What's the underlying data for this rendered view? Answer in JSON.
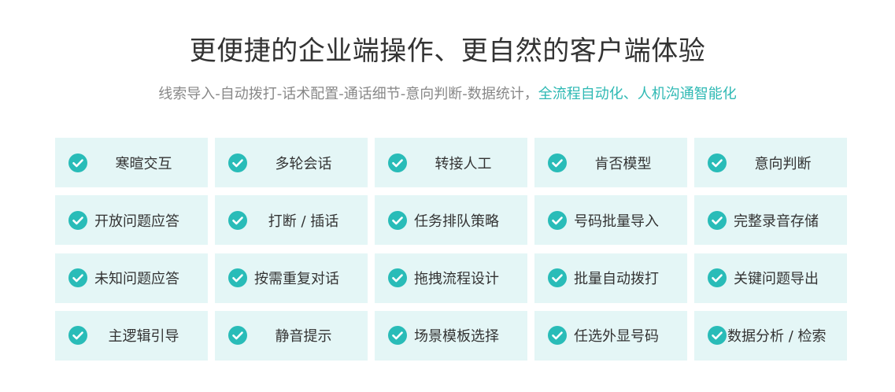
{
  "header": {
    "title": "更便捷的企业端操作、更自然的客户端体验",
    "subtitle_plain": "线索导入-自动拨打-话术配置-通话细节-意向判断-数据统计，",
    "subtitle_highlight": "全流程自动化、人机沟通智能化"
  },
  "colors": {
    "accent": "#29bcb8",
    "card_bg": "#e4f6f6",
    "title": "#333333",
    "subtitle": "#888888",
    "highlight": "#2fb9b4"
  },
  "features": [
    {
      "label": "寒暄交互",
      "icon": "check-circle-icon"
    },
    {
      "label": "多轮会话",
      "icon": "check-circle-icon"
    },
    {
      "label": "转接人工",
      "icon": "check-circle-icon"
    },
    {
      "label": "肯否模型",
      "icon": "check-circle-icon"
    },
    {
      "label": "意向判断",
      "icon": "check-circle-icon"
    },
    {
      "label": "开放问题应答",
      "icon": "check-circle-icon"
    },
    {
      "label": "打断 / 插话",
      "icon": "check-circle-icon"
    },
    {
      "label": "任务排队策略",
      "icon": "check-circle-icon"
    },
    {
      "label": "号码批量导入",
      "icon": "check-circle-icon"
    },
    {
      "label": "完整录音存储",
      "icon": "check-circle-icon"
    },
    {
      "label": "未知问题应答",
      "icon": "check-circle-icon"
    },
    {
      "label": "按需重复对话",
      "icon": "check-circle-icon"
    },
    {
      "label": "拖拽流程设计",
      "icon": "check-circle-icon"
    },
    {
      "label": "批量自动拨打",
      "icon": "check-circle-icon"
    },
    {
      "label": "关键问题导出",
      "icon": "check-circle-icon"
    },
    {
      "label": "主逻辑引导",
      "icon": "check-circle-icon"
    },
    {
      "label": "静音提示",
      "icon": "check-circle-icon"
    },
    {
      "label": "场景模板选择",
      "icon": "check-circle-icon"
    },
    {
      "label": "任选外显号码",
      "icon": "check-circle-icon"
    },
    {
      "label": "数据分析 / 检索",
      "icon": "check-circle-icon"
    }
  ]
}
